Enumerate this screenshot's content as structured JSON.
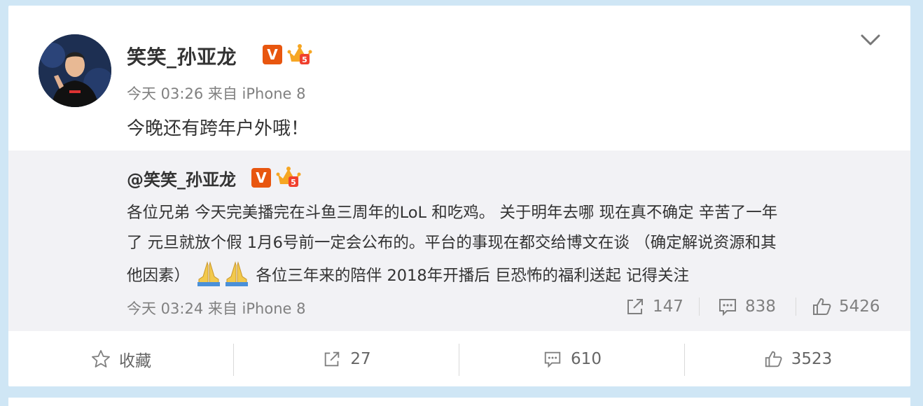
{
  "post": {
    "author": "笑笑_孙亚龙",
    "verified_badge": "V",
    "time_source": "今天 03:26 来自 iPhone 8",
    "text": "今晚还有跨年户外哦！"
  },
  "repost": {
    "author": "@笑笑_孙亚龙",
    "verified_badge": "V",
    "body_line1": "各位兄弟 今天完美播完在斗鱼三周年的LoL 和吃鸡。   关于明年去哪 现在真不确定 辛苦了一年",
    "body_line2": "了 元旦就放个假 1月6号前一定会公布的。平台的事现在都交给博文在谈  （确定解说资源和其",
    "body_line3_pre": "他因素）",
    "body_line3_post": "各位三年来的陪伴 2018年开播后 巨恐怖的福利送起 记得关注",
    "time_source": "今天 03:24 来自 iPhone 8",
    "reposts": "147",
    "comments": "838",
    "likes": "5426"
  },
  "actions": {
    "favorite_label": "收藏",
    "repost_count": "27",
    "comment_count": "610",
    "like_count": "3523"
  },
  "colors": {
    "background": "#cfe6f5",
    "card": "#ffffff",
    "repost_bg": "#f2f2f5",
    "badge_orange": "#e8560f",
    "meta_gray": "#808080"
  },
  "icons": [
    "chevron-down-icon",
    "crown-level-icon",
    "praying-hands-icon",
    "share-icon",
    "comment-icon",
    "thumbs-up-icon",
    "star-icon"
  ]
}
